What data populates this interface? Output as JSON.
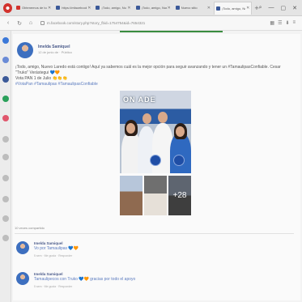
{
  "browser": {
    "tabs": [
      {
        "label": "Obtenemos de todo...",
        "favicon_color": "#d2322d"
      },
      {
        "label": "https://mfacebook...",
        "favicon_color": "#3b5998"
      },
      {
        "label": "¡Todo, amigo, Nuevo L...",
        "favicon_color": "#3b5998"
      },
      {
        "label": "¡Todo, amigo, Nuevo L...",
        "favicon_color": "#3b5998"
      },
      {
        "label": "Nuevo sitio",
        "favicon_color": "#3b5998"
      },
      {
        "label": "¡Todo, amigo, Nuevo L...",
        "favicon_color": "#3b5998"
      }
    ],
    "active_tab_index": 5,
    "url": "m.facebook.com/story.php?story_fbid=1754754&id=7654321",
    "loading_color": "#3a8c3f"
  },
  "post": {
    "author": "Imelda Samiquel",
    "meta": "12 de junio de · Público",
    "text": "¡Todo, amigo, Nuevo Laredo está contigo! Aquí ya sabemos cuál es la mejor opción para seguir avanzando y tener un #TamaulipasConfiable. Cesar \"Truko\" Verástegui 💙🧡",
    "text_line2": "Vota PAN 1 de Julio 👏👏👏",
    "hashtags": "#VotaPan #Tamaulipas #TamaulipasConfiable",
    "photo_banner": "ON ADE",
    "more_photos": "+28",
    "shares": "10 veces compartido"
  },
  "comments": [
    {
      "name": "Imelda Samiquel",
      "text": "Vo por Tamaulipas 💙🧡",
      "meta": "5 sem · Me gusta · Responder"
    },
    {
      "name": "Imelda Samiquel",
      "text": "Tamaulipecos con Truko 💙🧡 gracias por todo el apoyo",
      "meta": "5 sem · Me gusta · Responder"
    }
  ],
  "colors": {
    "brand_blue": "#3b5998",
    "link": "#5b7bbf",
    "accent_red": "#d2322d"
  }
}
